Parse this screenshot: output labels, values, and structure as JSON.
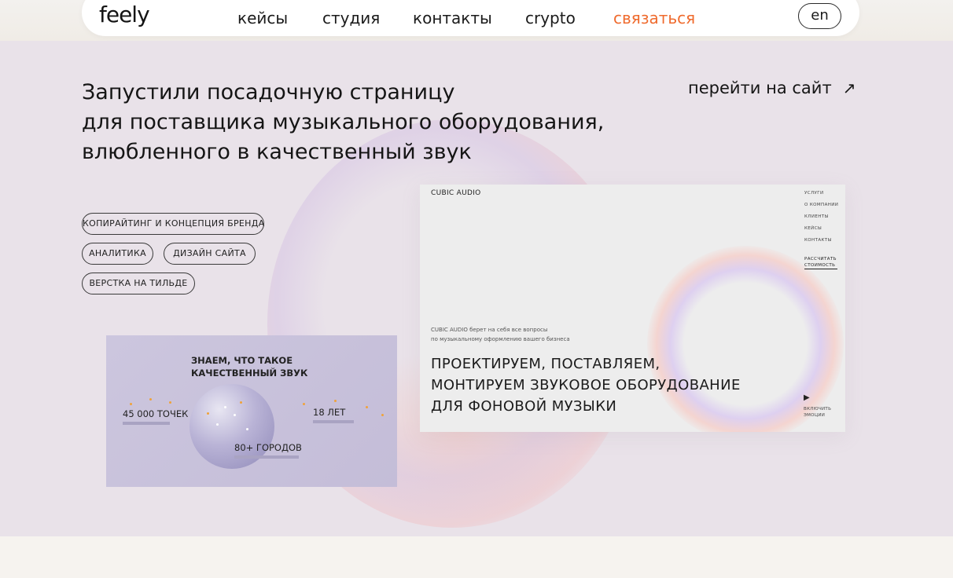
{
  "nav": {
    "logo": "feely",
    "items": [
      {
        "label": "кейсы"
      },
      {
        "label": "студия"
      },
      {
        "label": "контакты"
      },
      {
        "label": "crypto"
      }
    ],
    "cta": "связаться",
    "lang": "en",
    "accent_color": "#ef6b2e"
  },
  "hero": {
    "title_lines": [
      "Запустили посадочную страницу",
      "для поставщика музыкального оборудования,",
      "влюбленного в качественный звук"
    ],
    "site_link": "перейти на сайт",
    "site_link_icon": "arrow-up-right-icon",
    "tags": [
      "КОПИРАЙТИНГ И КОНЦЕПЦИЯ БРЕНДА",
      "АНАЛИТИКА",
      "ДИЗАЙН САЙТА",
      "ВЕРСТКА НА ТИЛЬДЕ"
    ],
    "background_color": "#e9e2e9"
  },
  "card_small": {
    "title": "ЗНАЕМ, ЧТО ТАКОЕ КАЧЕСТВЕННЫЙ ЗВУК",
    "stat_points": "45 000 ТОЧЕК",
    "stat_years": "18 ЛЕТ",
    "stat_cities": "80+ ГОРОДОВ"
  },
  "card_big": {
    "brand": "CUBIC AUDIO",
    "menu": [
      "УСЛУГИ",
      "О КОМПАНИИ",
      "КЛИЕНТЫ",
      "КЕЙСЫ",
      "КОНТАКТЫ"
    ],
    "cta_line1": "РАССЧИТАТЬ",
    "cta_line2": "СТОИМОСТЬ",
    "intro_line1": "CUBIC AUDIO берет на себя все вопросы",
    "intro_line2": "по музыкальному оформлению вашего бизнеса",
    "heading_lines": [
      "ПРОЕКТИРУЕМ, ПОСТАВЛЯЕМ,",
      "МОНТИРУЕМ ЗВУКОВОЕ ОБОРУДОВАНИЕ",
      "ДЛЯ ФОНОВОЙ МУЗЫКИ"
    ],
    "play_icon": "play-icon",
    "play_label_line1": "ВКЛЮЧИТЬ",
    "play_label_line2": "ЭМОЦИИ"
  }
}
